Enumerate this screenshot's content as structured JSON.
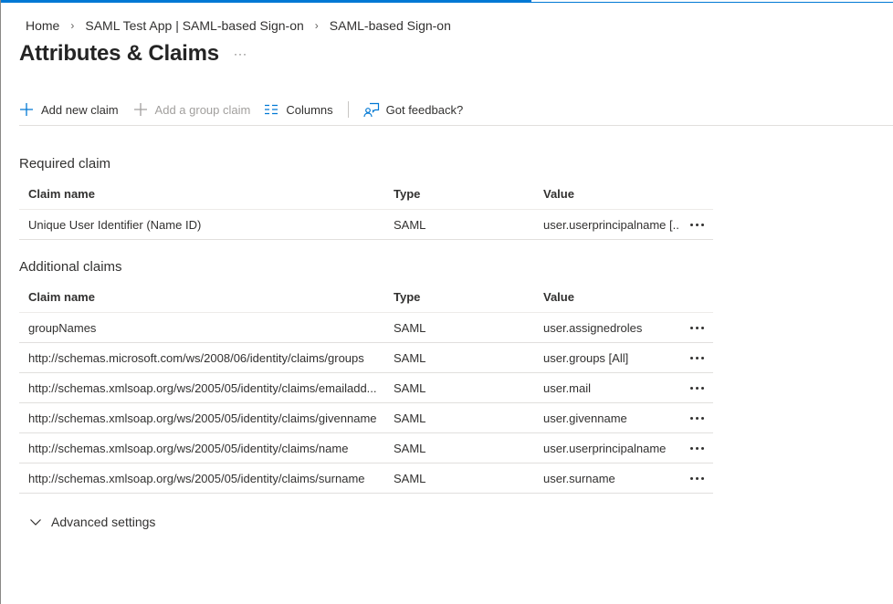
{
  "breadcrumb": {
    "items": [
      "Home",
      "SAML Test App | SAML-based Sign-on",
      "SAML-based Sign-on"
    ],
    "separator": "›"
  },
  "page": {
    "title": "Attributes & Claims",
    "more_label": "···"
  },
  "toolbar": {
    "add_claim": "Add new claim",
    "add_group_claim": "Add a group claim",
    "columns": "Columns",
    "feedback": "Got feedback?"
  },
  "required": {
    "title": "Required claim",
    "columns": {
      "name": "Claim name",
      "type": "Type",
      "value": "Value"
    },
    "rows": [
      {
        "name": "Unique User Identifier (Name ID)",
        "type": "SAML",
        "value": "user.userprincipalname [..."
      }
    ]
  },
  "additional": {
    "title": "Additional claims",
    "columns": {
      "name": "Claim name",
      "type": "Type",
      "value": "Value"
    },
    "rows": [
      {
        "name": "groupNames",
        "type": "SAML",
        "value": "user.assignedroles"
      },
      {
        "name": "http://schemas.microsoft.com/ws/2008/06/identity/claims/groups",
        "type": "SAML",
        "value": "user.groups [All]"
      },
      {
        "name": "http://schemas.xmlsoap.org/ws/2005/05/identity/claims/emailadd...",
        "type": "SAML",
        "value": "user.mail"
      },
      {
        "name": "http://schemas.xmlsoap.org/ws/2005/05/identity/claims/givenname",
        "type": "SAML",
        "value": "user.givenname"
      },
      {
        "name": "http://schemas.xmlsoap.org/ws/2005/05/identity/claims/name",
        "type": "SAML",
        "value": "user.userprincipalname"
      },
      {
        "name": "http://schemas.xmlsoap.org/ws/2005/05/identity/claims/surname",
        "type": "SAML",
        "value": "user.surname"
      }
    ]
  },
  "advanced": {
    "label": "Advanced settings"
  },
  "colors": {
    "accent": "#0078d4",
    "text": "#323130",
    "disabled": "#a19f9d"
  },
  "icons": [
    "add-icon",
    "columns-icon",
    "feedback-icon",
    "more-icon",
    "chevron-down-icon"
  ]
}
